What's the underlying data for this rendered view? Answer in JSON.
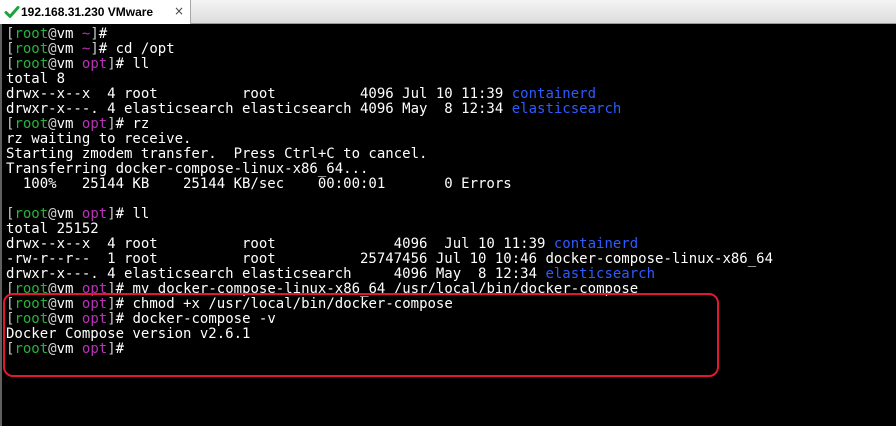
{
  "window": {
    "tab_title": "192.168.31.230 VMware",
    "tab_close": "×"
  },
  "terminal": {
    "lines": [
      {
        "prompt": {
          "user": "root",
          "host": "vm",
          "dir": "~"
        },
        "text": ""
      },
      {
        "prompt": {
          "user": "root",
          "host": "vm",
          "dir": "~"
        },
        "text": " cd /opt"
      },
      {
        "prompt": {
          "user": "root",
          "host": "vm",
          "dir": "opt"
        },
        "text": " ll"
      },
      {
        "text": "total 8"
      },
      {
        "text": "drwx--x--x  4 root          root          4096 Jul 10 11:39 ",
        "highlight": "containerd"
      },
      {
        "text": "drwxr-x---. 4 elasticsearch elasticsearch 4096 May  8 12:34 ",
        "highlight": "elasticsearch"
      },
      {
        "prompt": {
          "user": "root",
          "host": "vm",
          "dir": "opt"
        },
        "text": " rz"
      },
      {
        "text": "rz waiting to receive."
      },
      {
        "text": "Starting zmodem transfer.  Press Ctrl+C to cancel."
      },
      {
        "text": "Transferring docker-compose-linux-x86_64..."
      },
      {
        "text": "  100%   25144 KB    25144 KB/sec    00:00:01       0 Errors"
      },
      {
        "text": ""
      },
      {
        "prompt": {
          "user": "root",
          "host": "vm",
          "dir": "opt"
        },
        "text": " ll"
      },
      {
        "text": "total 25152"
      },
      {
        "text": "drwx--x--x  4 root          root              4096  Jul 10 11:39 ",
        "highlight": "containerd"
      },
      {
        "text": "-rw-r--r--  1 root          root          25747456 Jul 10 10:46 docker-compose-linux-x86_64"
      },
      {
        "text": "drwxr-x---. 4 elasticsearch elasticsearch     4096 May  8 12:34 ",
        "highlight": "elasticsearch"
      },
      {
        "prompt": {
          "user": "root",
          "host": "vm",
          "dir": "opt"
        },
        "text": " mv docker-compose-linux-x86_64 /usr/local/bin/docker-compose"
      },
      {
        "prompt": {
          "user": "root",
          "host": "vm",
          "dir": "opt"
        },
        "text": " chmod +x /usr/local/bin/docker-compose"
      },
      {
        "prompt": {
          "user": "root",
          "host": "vm",
          "dir": "opt"
        },
        "text": " docker-compose -v"
      },
      {
        "text": "Docker Compose version v2.6.1"
      },
      {
        "prompt": {
          "user": "root",
          "host": "vm",
          "dir": "opt"
        },
        "text": ""
      }
    ]
  },
  "colors": {
    "prompt_user": "#27b33a",
    "prompt_dir": "#b832b8",
    "directory": "#2e5bff",
    "annotation": "#e0192e"
  }
}
